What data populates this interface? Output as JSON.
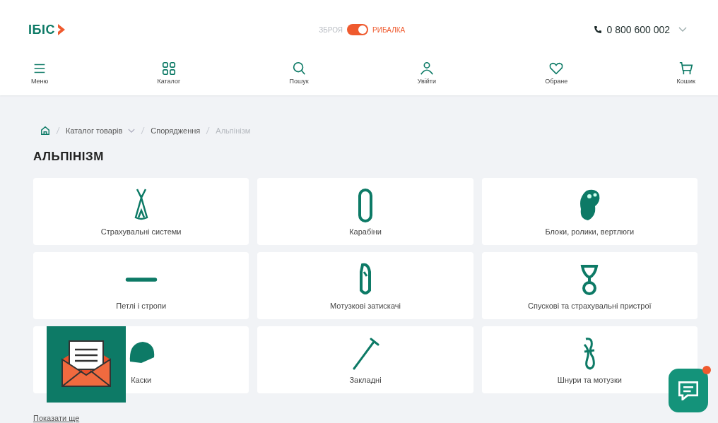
{
  "header": {
    "logo": "ІБІС",
    "mode_switch": {
      "left_label": "ЗБРОЯ",
      "right_label": "РИБАЛКА",
      "on": true
    },
    "phone": "0 800 600 002"
  },
  "nav": [
    {
      "kind": "menu",
      "label": "Меню"
    },
    {
      "kind": "catalog",
      "label": "Каталог"
    },
    {
      "kind": "search",
      "label": "Пошук"
    },
    {
      "kind": "user",
      "label": "Увійти"
    },
    {
      "kind": "heart",
      "label": "Обране"
    },
    {
      "kind": "cart",
      "label": "Кошик"
    }
  ],
  "breadcrumbs": [
    {
      "label": "Каталог товарів",
      "dropdown": true,
      "current": false
    },
    {
      "label": "Спорядження",
      "dropdown": false,
      "current": false
    },
    {
      "label": "Альпінізм",
      "dropdown": false,
      "current": true
    }
  ],
  "title": "АЛЬПІНІЗМ",
  "categories": [
    {
      "kind": "harness",
      "label": "Страхувальні системи"
    },
    {
      "kind": "carabiner",
      "label": "Карабіни"
    },
    {
      "kind": "pulley",
      "label": "Блоки, ролики, вертлюги"
    },
    {
      "kind": "sling",
      "label": "Петлі і стропи"
    },
    {
      "kind": "ascender",
      "label": "Мотузкові затискачі"
    },
    {
      "kind": "eight",
      "label": "Спускові та страхувальні пристрої"
    },
    {
      "kind": "helmet",
      "label": "Каски"
    },
    {
      "kind": "nut",
      "label": "Закладні"
    },
    {
      "kind": "rope",
      "label": "Шнури та мотузки"
    }
  ],
  "show_more": "Показати ще",
  "chat": {
    "unread": true
  }
}
